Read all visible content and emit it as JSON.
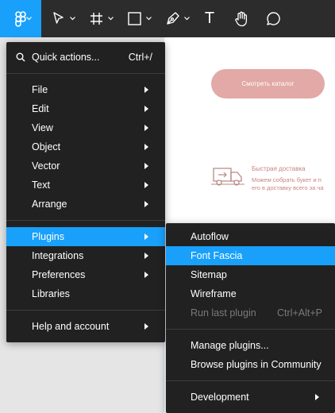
{
  "toolbar": {
    "tools": [
      {
        "icon": "figma-main-menu-icon",
        "active": true
      },
      {
        "icon": "move-tool-icon"
      },
      {
        "icon": "frame-tool-icon"
      },
      {
        "icon": "shape-tool-icon"
      },
      {
        "icon": "pen-tool-icon"
      },
      {
        "icon": "text-tool-icon",
        "glyph": "T"
      },
      {
        "icon": "hand-tool-icon"
      },
      {
        "icon": "comment-tool-icon"
      }
    ]
  },
  "canvas": {
    "catalog_button": "Смотреть каталог",
    "delivery": {
      "title": "Быстрая доставка",
      "text_line1": "Можем собрать букет и п",
      "text_line2": "его в доставку всего за ча"
    }
  },
  "main_menu": {
    "quick_actions": {
      "label": "Quick actions...",
      "shortcut": "Ctrl+/"
    },
    "items": [
      {
        "label": "File"
      },
      {
        "label": "Edit"
      },
      {
        "label": "View"
      },
      {
        "label": "Object"
      },
      {
        "label": "Vector"
      },
      {
        "label": "Text"
      },
      {
        "label": "Arrange"
      },
      {
        "label": "Plugins"
      },
      {
        "label": "Integrations"
      },
      {
        "label": "Preferences"
      },
      {
        "label": "Libraries"
      },
      {
        "label": "Help and account"
      }
    ]
  },
  "plugins_menu": {
    "items": [
      {
        "label": "Autoflow"
      },
      {
        "label": "Font Fascia"
      },
      {
        "label": "Sitemap"
      },
      {
        "label": "Wireframe"
      },
      {
        "label": "Run last plugin",
        "shortcut": "Ctrl+Alt+P"
      },
      {
        "label": "Manage plugins..."
      },
      {
        "label": "Browse plugins in Community"
      },
      {
        "label": "Development"
      }
    ]
  },
  "colors": {
    "accent": "#18a0fb",
    "menu_bg": "#212121",
    "toolbar_bg": "#2c2c2c",
    "brand_pink": "#e2a9a6"
  }
}
